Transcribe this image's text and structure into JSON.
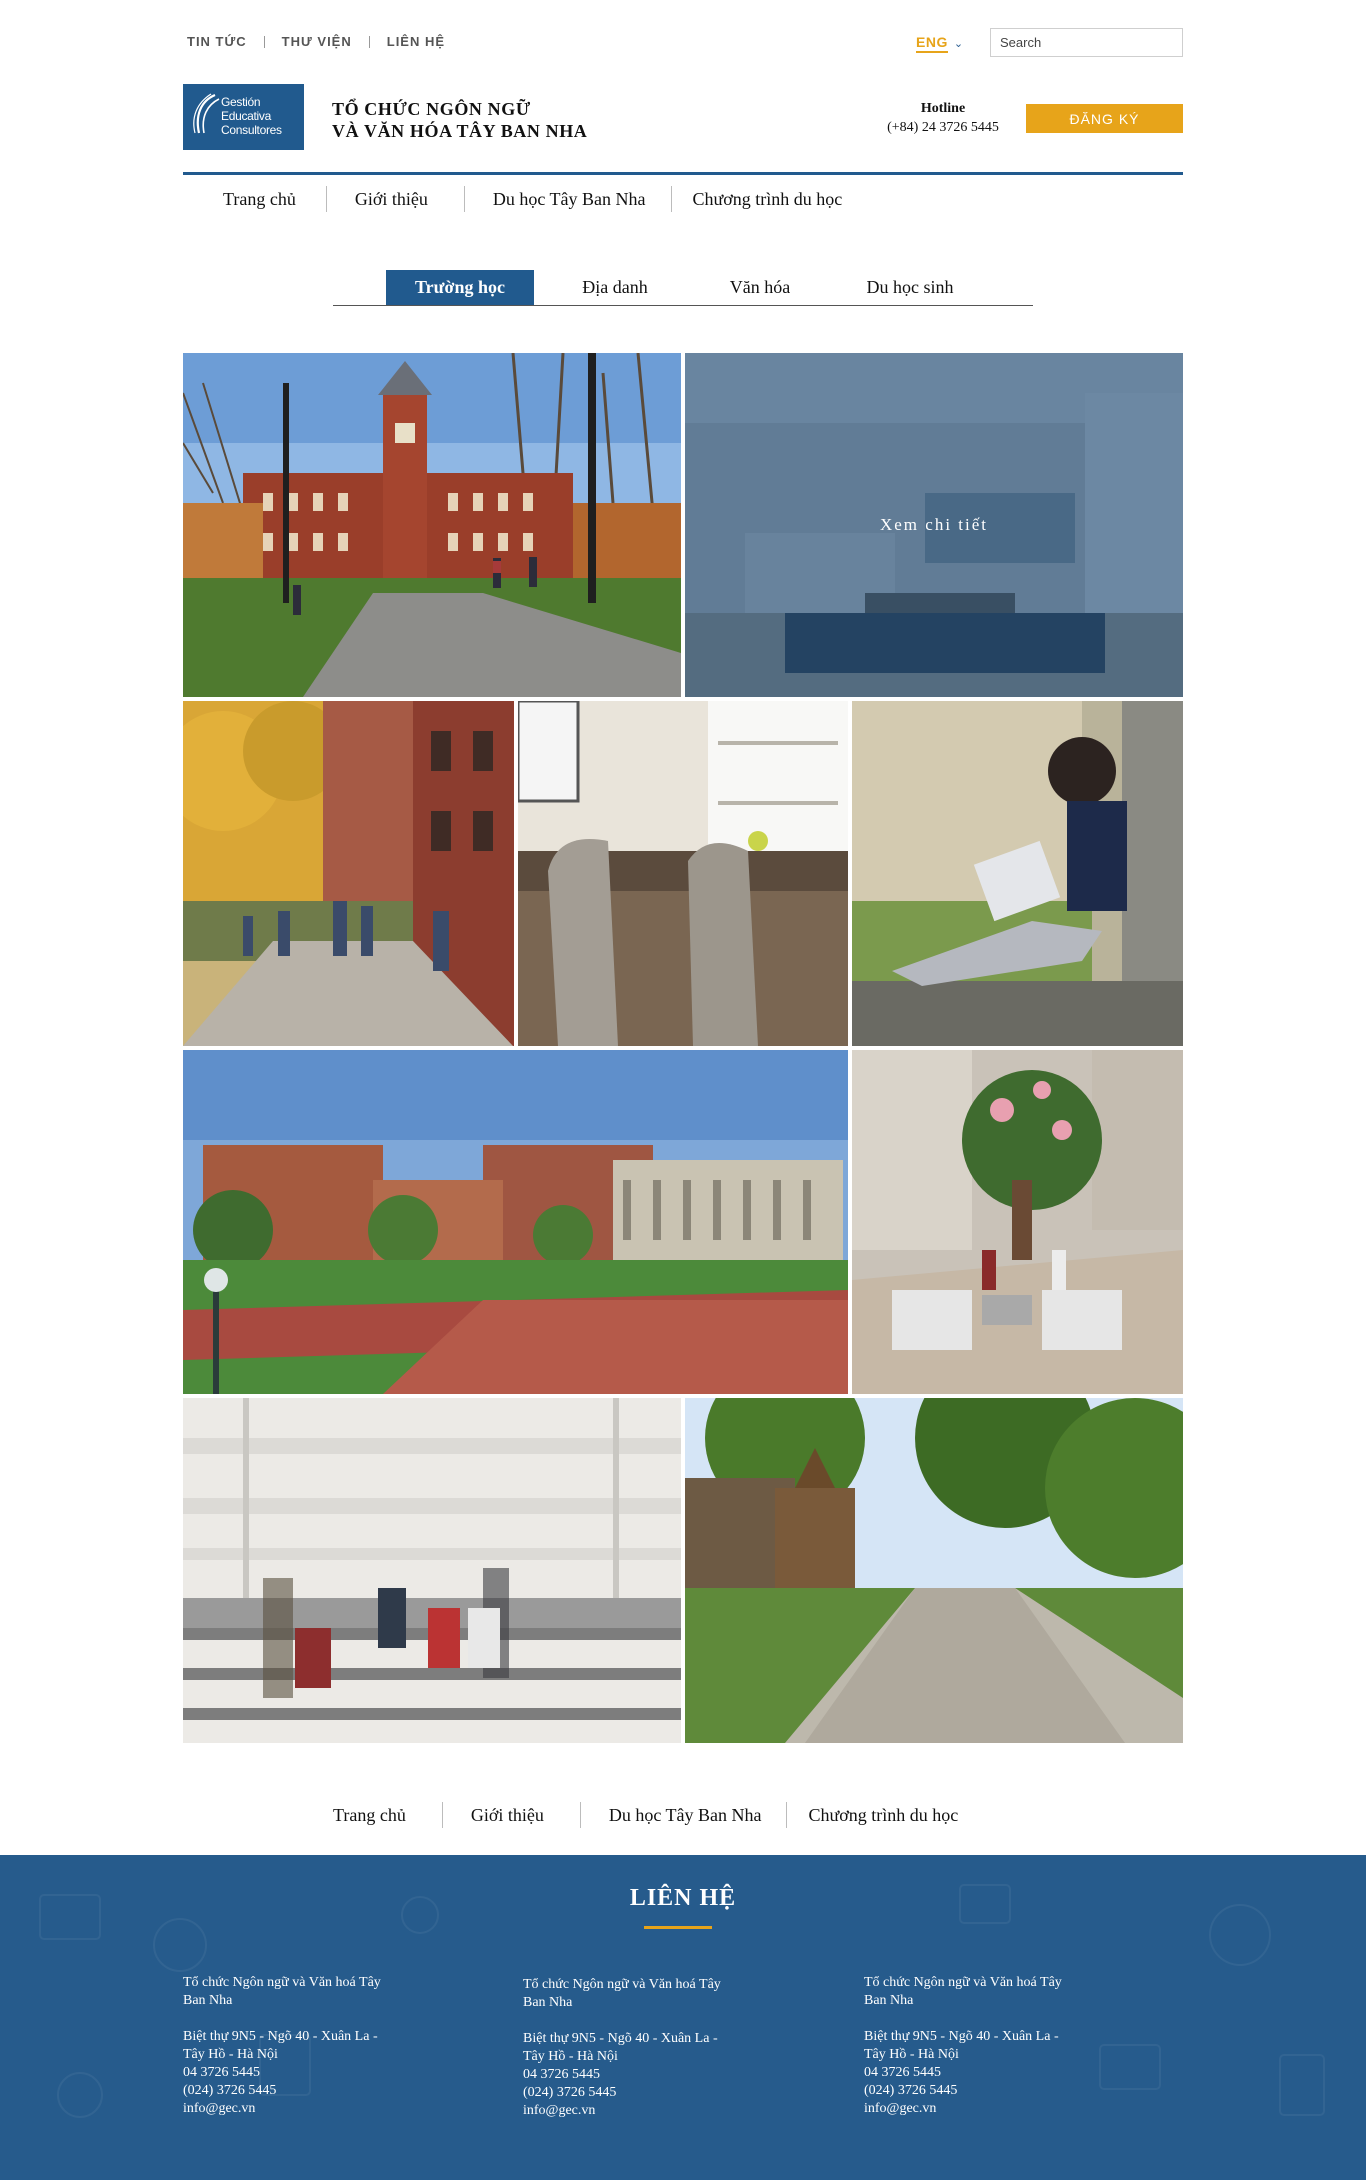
{
  "topbar": {
    "links": [
      "TIN TỨC",
      "THƯ VIỆN",
      "LIÊN HỆ"
    ],
    "language": "ENG",
    "search_placeholder": "Search"
  },
  "brand": {
    "logo_lines": [
      "Gestión",
      "Educativa",
      "Consultores"
    ],
    "title_line1": "TỔ CHỨC NGÔN NGỮ",
    "title_line2": "VÀ VĂN HÓA TÂY BAN NHA",
    "hotline_label": "Hotline",
    "hotline_number": "(+84) 24 3726 5445",
    "register_label": "ĐĂNG KÝ"
  },
  "nav": {
    "items": [
      "Trang chủ",
      "Giới thiệu",
      "Du học Tây Ban Nha",
      "Chương trình du học"
    ]
  },
  "gallery": {
    "tabs": [
      "Trường học",
      "Địa danh",
      "Văn hóa",
      "Du học sinh"
    ],
    "active_tab": "Trường học",
    "detail_label": "Xem chi tiết"
  },
  "footer": {
    "title": "LIÊN HỆ",
    "columns": [
      {
        "org_line1": "Tổ chức Ngôn ngữ và Văn hoá Tây",
        "org_line2": "Ban Nha",
        "addr_line1": "Biệt thự 9N5 - Ngõ 40 - Xuân La -",
        "addr_line2": "Tây Hồ - Hà Nội",
        "phone1": "04 3726 5445",
        "phone2": "(024) 3726 5445",
        "email": "info@gec.vn"
      },
      {
        "org_line1": "Tổ chức Ngôn ngữ và Văn hoá Tây",
        "org_line2": "Ban Nha",
        "addr_line1": "Biệt thự 9N5 - Ngõ 40 - Xuân La -",
        "addr_line2": "Tây Hồ - Hà Nội",
        "phone1": "04 3726 5445",
        "phone2": "(024) 3726 5445",
        "email": "info@gec.vn"
      },
      {
        "org_line1": "Tổ chức Ngôn ngữ và Văn hoá Tây",
        "org_line2": "Ban Nha",
        "addr_line1": "Biệt thự 9N5 - Ngõ 40 - Xuân La -",
        "addr_line2": "Tây Hồ - Hà Nội",
        "phone1": "04 3726 5445",
        "phone2": "(024) 3726 5445",
        "email": "info@gec.vn"
      }
    ]
  },
  "colors": {
    "brand_blue": "#215a8e",
    "accent_orange": "#e7a41a",
    "footer_blue": "#265b8c"
  }
}
